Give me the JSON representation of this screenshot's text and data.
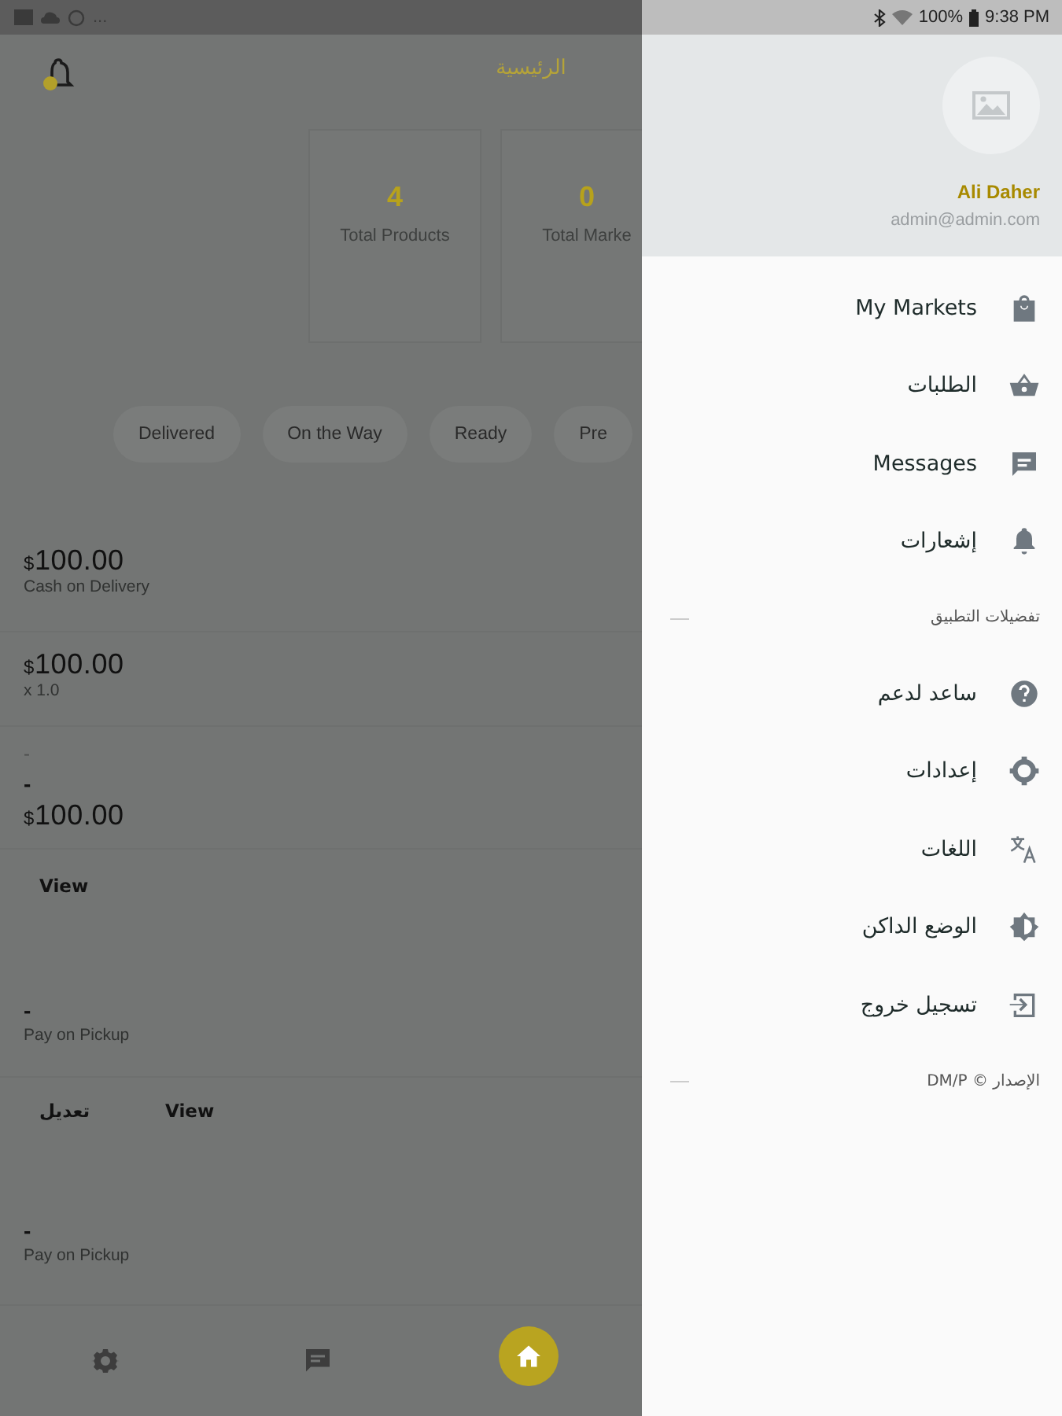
{
  "status_bar": {
    "overflow": "...",
    "battery": "100%",
    "time": "9:38 PM"
  },
  "header": {
    "title": "الرئيسية"
  },
  "stats": [
    {
      "value": "0",
      "label": "Total Marke"
    },
    {
      "value": "4",
      "label": "Total Products"
    }
  ],
  "chips": [
    "Pre",
    "Ready",
    "On the Way",
    "Delivered"
  ],
  "order_sections": [
    {
      "lines": [
        {
          "kind": "amount",
          "currency": "$",
          "text": "100.00"
        },
        {
          "kind": "note",
          "text": "Cash on Delivery"
        }
      ]
    },
    {
      "lines": [
        {
          "kind": "amount",
          "currency": "$",
          "text": "100.00"
        },
        {
          "kind": "note",
          "text": "x 1.0"
        }
      ]
    },
    {
      "lines": [
        {
          "kind": "faint",
          "text": "-"
        },
        {
          "kind": "dash",
          "text": "-"
        },
        {
          "kind": "amount",
          "currency": "$",
          "text": "100.00"
        }
      ]
    },
    {
      "lines": [
        {
          "kind": "actions",
          "buttons": [
            "View"
          ]
        }
      ]
    },
    {
      "lines": [
        {
          "kind": "dash",
          "text": "-"
        },
        {
          "kind": "note",
          "text": "Pay on Pickup"
        }
      ]
    },
    {
      "lines": [
        {
          "kind": "actions",
          "buttons": [
            "View",
            "تعديل"
          ]
        }
      ]
    },
    {
      "lines": [
        {
          "kind": "dash",
          "text": "-"
        },
        {
          "kind": "note",
          "text": "Pay on Pickup"
        }
      ]
    }
  ],
  "bottom_nav": [
    {
      "selected": false
    },
    {
      "selected": false
    },
    {
      "selected": true
    }
  ],
  "drawer": {
    "name": "Ali Daher",
    "email": "admin@admin.com",
    "items": [
      {
        "kind": "item",
        "label": "My Markets"
      },
      {
        "kind": "item",
        "label": "الطلبات"
      },
      {
        "kind": "item",
        "label": "Messages"
      },
      {
        "kind": "item",
        "label": "إشعارات"
      },
      {
        "kind": "section",
        "label": "تفضيلات التطبيق"
      },
      {
        "kind": "item",
        "label": "ساعد لدعم"
      },
      {
        "kind": "item",
        "label": "إعدادات"
      },
      {
        "kind": "item",
        "label": "اللغات"
      },
      {
        "kind": "item",
        "label": "الوضع الداكن"
      },
      {
        "kind": "item",
        "label": "تسجيل خروج"
      },
      {
        "kind": "section",
        "label": "الإصدار © DM/P"
      }
    ]
  }
}
